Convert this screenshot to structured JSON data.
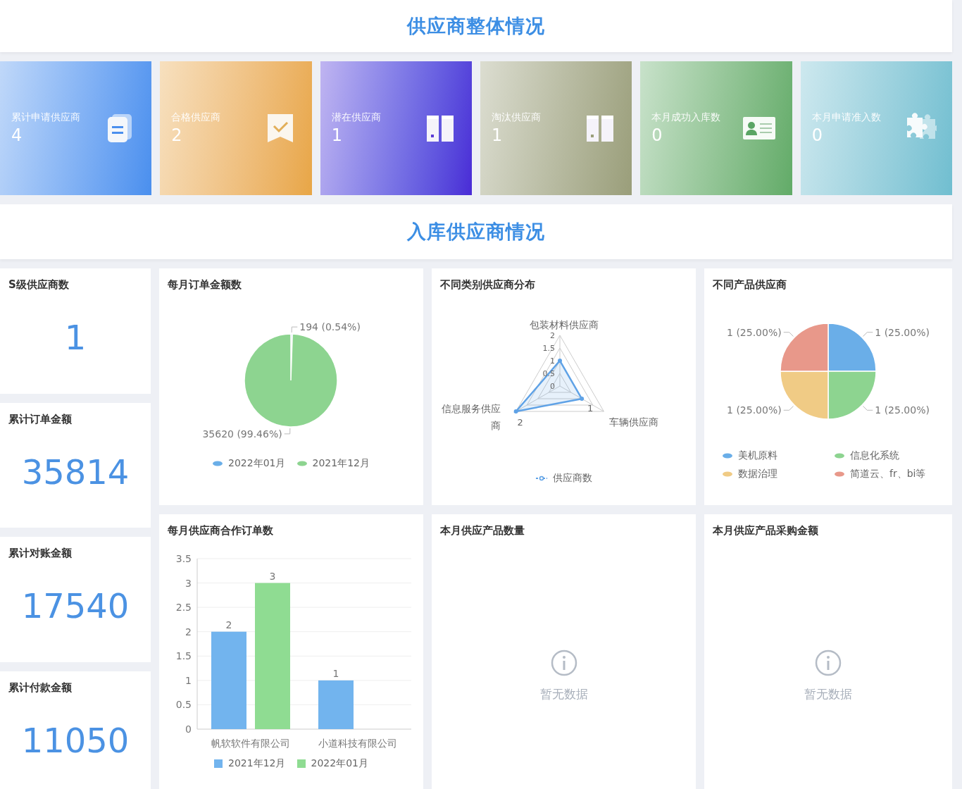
{
  "header": {
    "title": "供应商整体情况"
  },
  "summary_cards": [
    {
      "label": "累计申请供应商",
      "value": "4",
      "color": "#4a8fee"
    },
    {
      "label": "合格供应商",
      "value": "2",
      "color": "#e8a646"
    },
    {
      "label": "潜在供应商",
      "value": "1",
      "color": "#4a2ad6"
    },
    {
      "label": "淘汰供应商",
      "value": "1",
      "color": "#9a9e7a"
    },
    {
      "label": "本月成功入库数",
      "value": "0",
      "color": "#62ab68"
    },
    {
      "label": "本月申请准入数",
      "value": "0",
      "color": "#70bed0"
    }
  ],
  "section": {
    "title": "入库供应商情况"
  },
  "stats": [
    {
      "label": "S级供应商数",
      "value": "1"
    },
    {
      "label": "累计订单金额",
      "value": "35814"
    },
    {
      "label": "累计对账金额",
      "value": "17540"
    },
    {
      "label": "累计付款金额",
      "value": "11050"
    }
  ],
  "monthly_order_amount": {
    "title": "每月订单金额数",
    "chart_data": {
      "type": "pie",
      "categories": [
        "2022年01月",
        "2021年12月"
      ],
      "values": [
        194,
        35620
      ],
      "colors": [
        "#6aaee8",
        "#8dd490"
      ],
      "value_labels": [
        "194 (0.54%)",
        "35620 (99.46%)"
      ]
    }
  },
  "supplier_categories": {
    "title": "不同类别供应商分布",
    "radar": {
      "axis_labels": [
        "包装材料供应商",
        "车辆供应商",
        "信息服务供应商"
      ],
      "tick_labels": [
        "2",
        "1.5",
        "1",
        "0.5",
        "0"
      ],
      "point_labels": [
        "1",
        "2"
      ],
      "legend": "供应商数"
    }
  },
  "product_suppliers": {
    "title": "不同产品供应商",
    "chart_data": {
      "type": "pie",
      "categories": [
        "美机原料",
        "信息化系统",
        "数据治理",
        "简道云、fr、bi等"
      ],
      "values": [
        1,
        1,
        1,
        1
      ],
      "colors": [
        "#6aaee8",
        "#8dd490",
        "#f0cb85",
        "#e8988a"
      ],
      "value_labels": [
        "1 (25.00%)",
        "1 (25.00%)",
        "1 (25.00%)",
        "1 (25.00%)"
      ]
    }
  },
  "monthly_orders": {
    "title": "每月供应商合作订单数",
    "chart_data": {
      "type": "bar",
      "categories": [
        "帆软软件有限公司",
        "小道科技有限公司"
      ],
      "series": [
        {
          "name": "2021年12月",
          "color": "#72b4ee",
          "values": [
            2,
            1
          ]
        },
        {
          "name": "2022年01月",
          "color": "#8fdc92",
          "values": [
            3,
            null
          ]
        }
      ],
      "ylim": [
        0,
        3.5
      ],
      "yticks": [
        0,
        0.5,
        1,
        1.5,
        2,
        2.5,
        3,
        3.5
      ],
      "grid": true,
      "data_labels": true
    }
  },
  "empty_panels": [
    {
      "title": "本月供应产品数量",
      "message": "暂无数据"
    },
    {
      "title": "本月供应产品采购金额",
      "message": "暂无数据"
    }
  ]
}
